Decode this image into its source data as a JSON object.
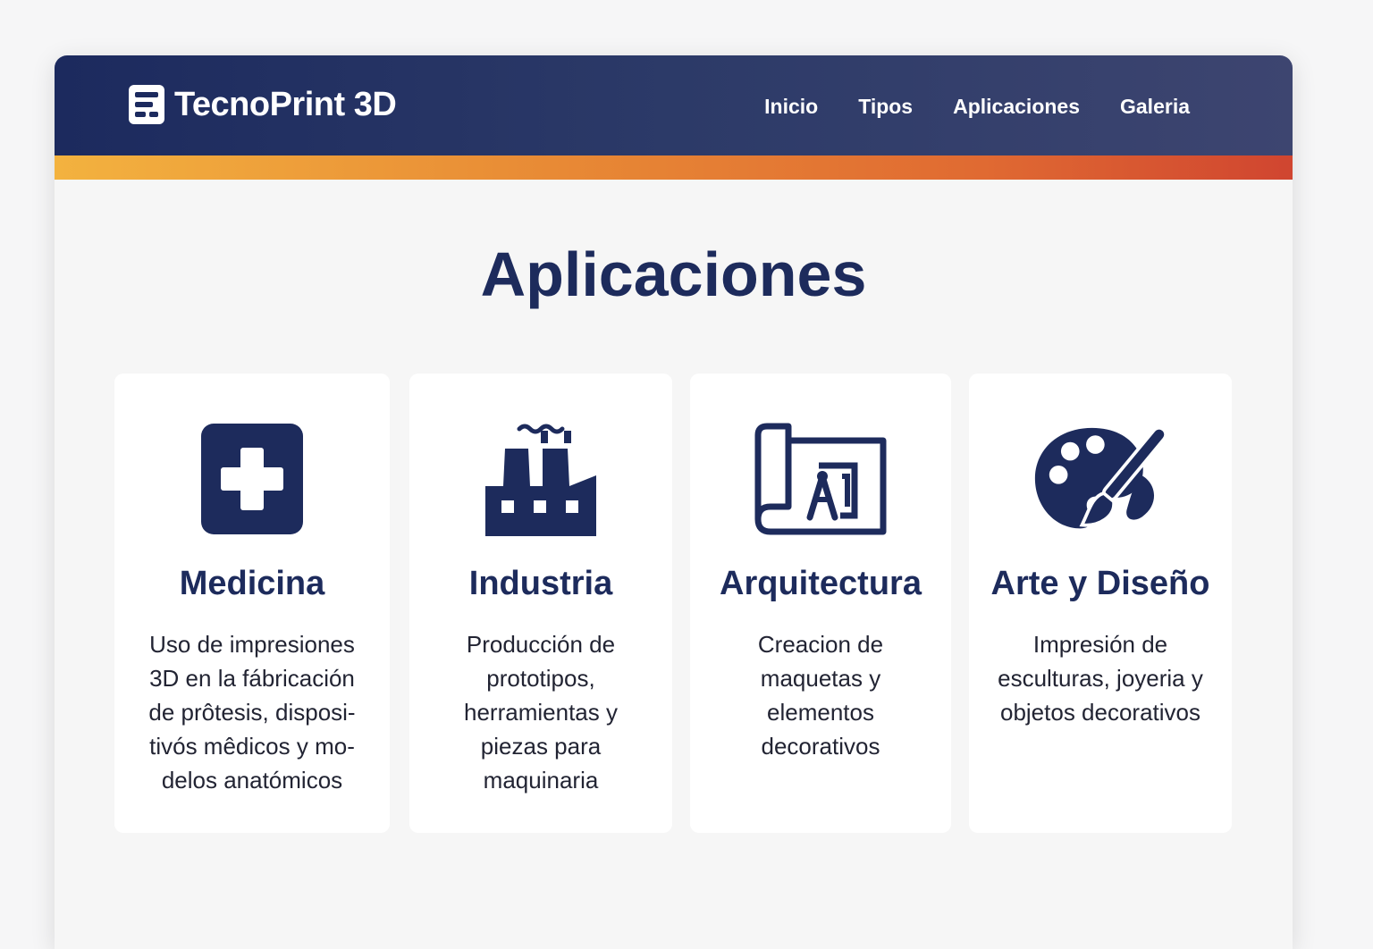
{
  "header": {
    "brand_name": "TecnoPrint 3D",
    "logo_icon": "tecnoprint-logo-icon",
    "nav": [
      "Inicio",
      "Tipos",
      "Aplicaciones",
      "Galeria"
    ]
  },
  "main": {
    "title": "Aplicaciones",
    "cards": [
      {
        "icon": "medical-cross-icon",
        "title": "Medicina",
        "description": "Uso de impresiones 3D en la fábricación de prôtesis, disposi-tivós mêdicos y mo-delos anatómicos"
      },
      {
        "icon": "factory-icon",
        "title": "Industria",
        "description": "Producción de prototipos, herramientas y piezas para maquinaria"
      },
      {
        "icon": "blueprint-compass-icon",
        "title": "Arquitectura",
        "description": "Creacion de maquetas y elementos decorativos"
      },
      {
        "icon": "palette-brush-icon",
        "title": "Arte y Diseño",
        "description": "Impresión de esculturas, joyeria y objetos decorativos"
      }
    ]
  },
  "colors": {
    "header_bg": "#1c2a5e",
    "primary_text": "#1d2b5c",
    "accent_start": "#f3b23f",
    "accent_end": "#d04530",
    "icon": "#1d2b5c"
  }
}
